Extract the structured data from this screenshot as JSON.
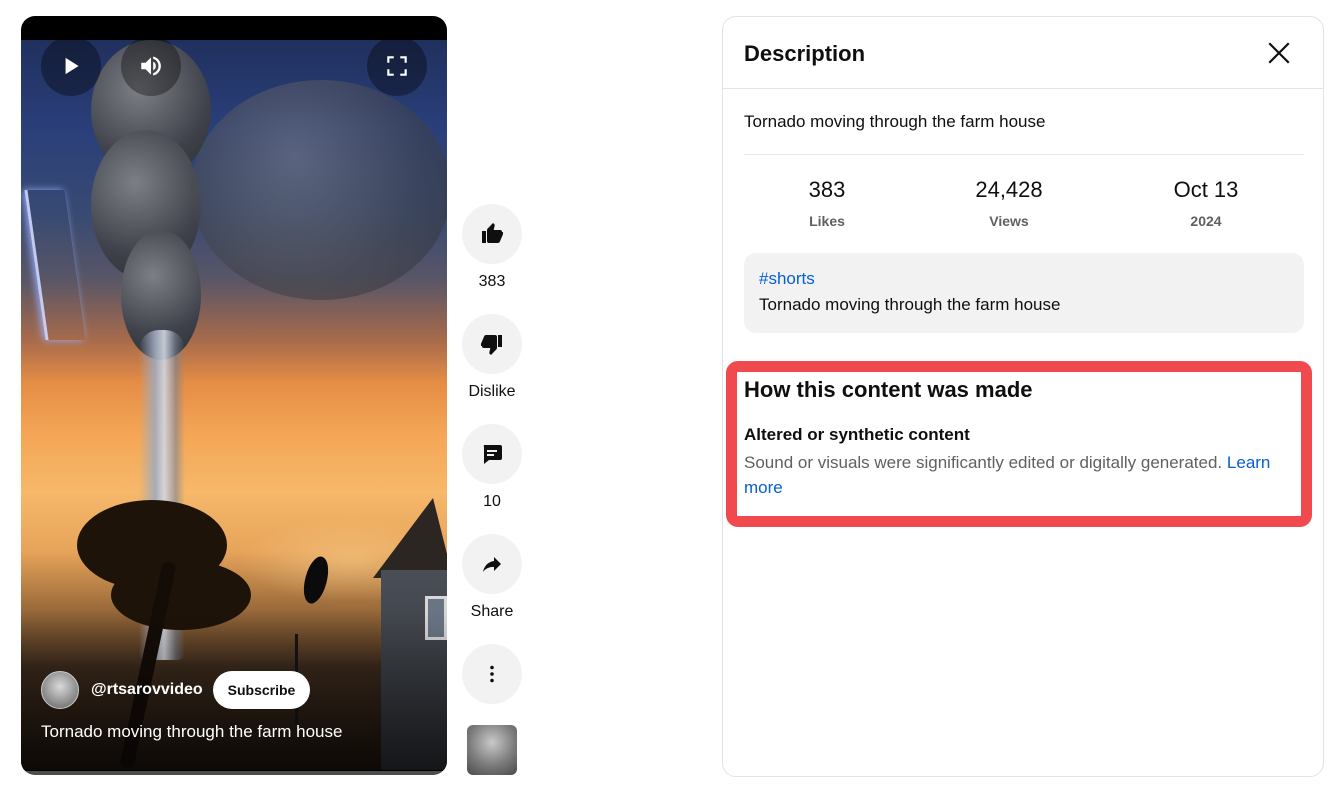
{
  "player": {
    "controls": {
      "play_icon": "play-icon",
      "volume_icon": "volume-icon",
      "fullscreen_icon": "fullscreen-icon"
    },
    "channel": {
      "handle": "@rtsarovvideo",
      "subscribe_label": "Subscribe"
    },
    "title": "Tornado moving through the farm house"
  },
  "actions": {
    "like": {
      "icon": "thumbs-up-icon",
      "label": "383"
    },
    "dislike": {
      "icon": "thumbs-down-icon",
      "label": "Dislike"
    },
    "comments": {
      "icon": "comment-icon",
      "label": "10"
    },
    "share": {
      "icon": "share-icon",
      "label": "Share"
    },
    "more": {
      "icon": "more-vertical-icon"
    }
  },
  "description_panel": {
    "title": "Description",
    "close_icon": "close-icon",
    "summary": "Tornado moving through the farm house",
    "stats": [
      {
        "value": "383",
        "label": "Likes"
      },
      {
        "value": "24,428",
        "label": "Views"
      },
      {
        "value": "Oct 13",
        "label": "2024"
      }
    ],
    "description": {
      "hashtag": "#shorts",
      "text": "Tornado moving through the farm house"
    },
    "content_made": {
      "title": "How this content was made",
      "subtitle": "Altered or synthetic content",
      "body": "Sound or visuals were significantly edited or digitally generated.",
      "link": "Learn more"
    }
  },
  "colors": {
    "accent_link": "#065fd4",
    "highlight_border": "#f04a4f",
    "chip_bg": "#f2f2f2"
  }
}
